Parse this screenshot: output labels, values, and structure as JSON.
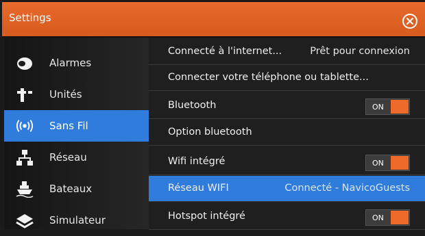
{
  "window": {
    "title": "Settings",
    "close_icon": "close-icon"
  },
  "colors": {
    "accent": "#e86a2c",
    "selection": "#2f7cdc",
    "toggle_on": "#ee6a2a"
  },
  "sidebar": {
    "items": [
      {
        "label": "Alarmes",
        "icon": "alarm-speaker-icon"
      },
      {
        "label": "Unités",
        "icon": "units-icon"
      },
      {
        "label": "Sans Fil",
        "icon": "wireless-icon",
        "active": true
      },
      {
        "label": "Réseau",
        "icon": "network-icon"
      },
      {
        "label": "Bateaux",
        "icon": "boats-icon"
      },
      {
        "label": "Simulateur",
        "icon": "simulator-icon"
      }
    ]
  },
  "settings": {
    "rows": [
      {
        "label": "Connecté à l'internet...",
        "value": "Prêt pour connexion"
      },
      {
        "label": "Connecter votre téléphone ou tablette..."
      },
      {
        "label": "Bluetooth",
        "toggle": "ON"
      },
      {
        "label": "Option bluetooth"
      },
      {
        "label": "Wifi intégré",
        "toggle": "ON"
      },
      {
        "label": "Réseau WIFI",
        "value": "Connecté - NavicoGuests",
        "selected": true
      },
      {
        "label": "Hotspot intégré",
        "toggle": "ON"
      }
    ]
  }
}
